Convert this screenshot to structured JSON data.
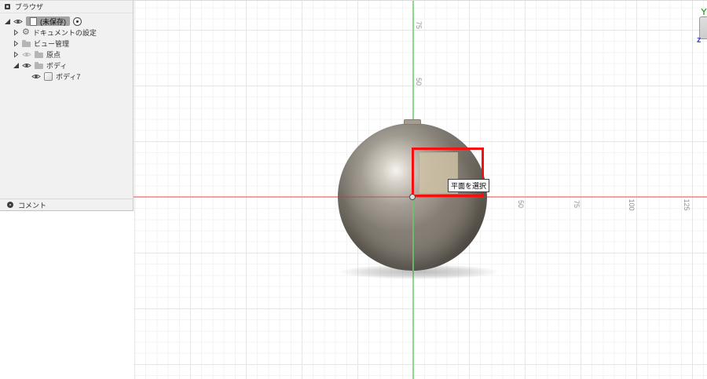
{
  "browser_panel": {
    "title": "ブラウザ",
    "comments_label": "コメント",
    "tree": [
      {
        "label": "(未保存)",
        "selected": true
      },
      {
        "label": "ドキュメントの設定"
      },
      {
        "label": "ビュー管理"
      },
      {
        "label": "原点"
      },
      {
        "label": "ボディ"
      },
      {
        "label": "ボディ7"
      }
    ],
    "gear_glyph": "⚙"
  },
  "viewport": {
    "tooltip": "平面を選択",
    "v_axis_labels": [
      {
        "text": "75"
      },
      {
        "text": "50"
      }
    ],
    "h_axis_labels": [
      {
        "text": "50"
      },
      {
        "text": "75"
      },
      {
        "text": "100"
      },
      {
        "text": "125"
      }
    ],
    "nav_z_label": "z",
    "colors": {
      "axis_x": "#f2a0a0",
      "axis_y": "#8cd98c",
      "selection_rect": "#f50f0f",
      "plane_highlight": "#cfc2a6",
      "grid_minor": "#f3f3f3",
      "grid_major": "#e6e6e6",
      "sphere_base": "#746e65"
    }
  }
}
